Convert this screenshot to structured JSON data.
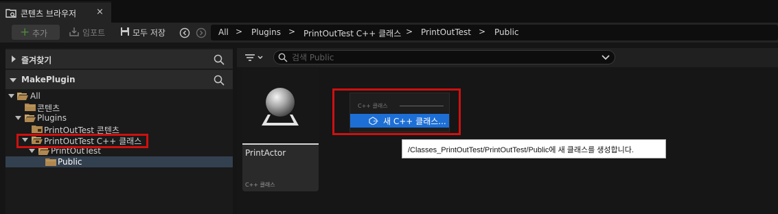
{
  "tab": {
    "label": "콘텐츠 브라우저",
    "close": "×",
    "icon": "content-browser-icon"
  },
  "toolbar": {
    "add_label": "추가",
    "import_label": "임포트",
    "save_all_label": "모두 저장",
    "breadcrumb": [
      "All",
      "Plugins",
      "PrintOutTest C++ 클래스",
      "PrintOutTest",
      "Public"
    ],
    "separator": ">"
  },
  "left_panel": {
    "favorites_title": "즐겨찾기",
    "project_title": "MakePlugin",
    "tree": [
      {
        "label": "All",
        "expanded": true,
        "selected": false
      },
      {
        "label": "콘텐츠",
        "expanded": false,
        "selected": false
      },
      {
        "label": "Plugins",
        "expanded": true,
        "selected": false
      },
      {
        "label": "PrintOutTest 콘텐츠",
        "expanded": false,
        "selected": false
      },
      {
        "label": "PrintOutTest C++ 클래스",
        "expanded": true,
        "selected": false
      },
      {
        "label": "PrintOutTest",
        "expanded": true,
        "selected": false
      },
      {
        "label": "Public",
        "expanded": false,
        "selected": true
      }
    ]
  },
  "content": {
    "search_placeholder": "검색 Public",
    "asset": {
      "name": "PrintActor",
      "type": "C++ 클래스"
    },
    "context_menu": {
      "header": "C++ 클래스",
      "item_label": "새 C++ 클래스..."
    },
    "tooltip": "/Classes_PrintOutTest/PrintOutTest/Public에 새 클래스를 생성합니다."
  },
  "colors": {
    "highlight": "#d01010",
    "selection": "#1d6fd6",
    "tree_selected": "#33404f",
    "add_plus": "#4e8a3a"
  }
}
